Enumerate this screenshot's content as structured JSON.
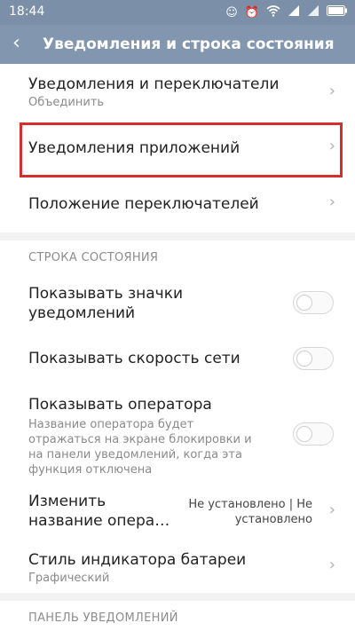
{
  "statusbar": {
    "time": "18:44",
    "icons": [
      "android-icon",
      "alarm-icon",
      "wifi-icon",
      "signal-icon",
      "signal-icon",
      "battery-icon"
    ]
  },
  "appbar": {
    "back_icon": "back-arrow-icon",
    "title": "Уведомления и строка состояния"
  },
  "rows_top": [
    {
      "label": "Уведомления и переключатели",
      "sub": "Объединить"
    },
    {
      "label": "Уведомления приложений"
    },
    {
      "label": "Положение переключателей"
    }
  ],
  "status_section": {
    "title": "СТРОКА СОСТОЯНИЯ",
    "show_icons": {
      "label": "Показывать значки уведомлений"
    },
    "net_speed": {
      "label": "Показывать скорость сети"
    },
    "operator": {
      "label": "Показывать оператора",
      "sub": "Название оператора будет отражаться на экране блокировки и на панели уведомлений, когда эта функция отключена"
    },
    "change_name": {
      "label": "Изменить название опера…",
      "value": "Не установлено | Не установлено"
    },
    "battery_style": {
      "label": "Стиль индикатора батареи",
      "sub": "Графический"
    }
  },
  "notif_section": {
    "title": "ПАНЕЛЬ УВЕДОМЛЕНИЙ"
  },
  "colors": {
    "highlight": "#d32f2f",
    "appbar": "#8296b0"
  }
}
